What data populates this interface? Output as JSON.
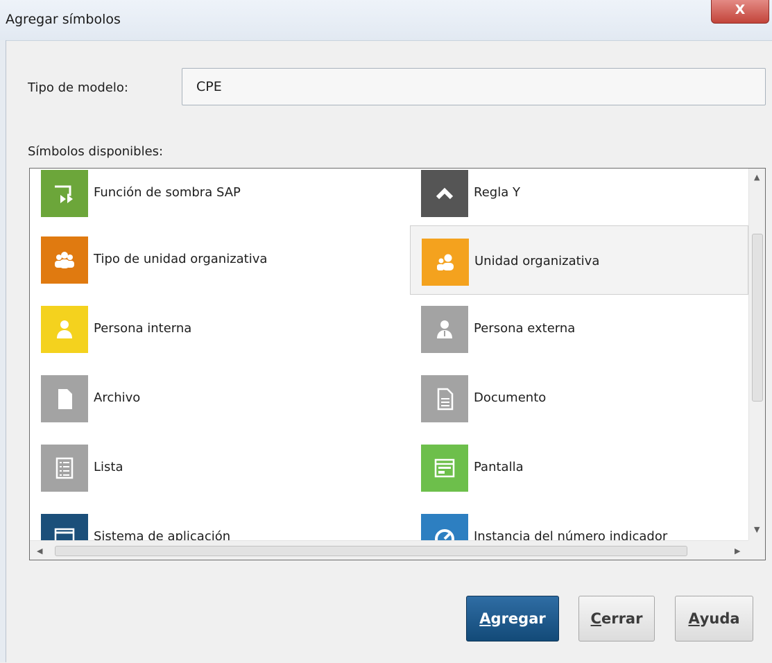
{
  "window": {
    "title": "Agregar símbolos",
    "close_glyph": "X"
  },
  "model_type": {
    "label": "Tipo de modelo:",
    "value": "CPE"
  },
  "symbols": {
    "label": "Símbolos disponibles:",
    "items": [
      {
        "label": "Función de sombra SAP",
        "icon": "shadow-function-icon",
        "color": "#6ca63a"
      },
      {
        "label": "Regla Y",
        "icon": "and-rule-icon",
        "color": "#555555"
      },
      {
        "label": "Tipo de unidad organizativa",
        "icon": "org-unit-type-icon",
        "color": "#e07a10"
      },
      {
        "label": "Unidad organizativa",
        "icon": "org-unit-icon",
        "color": "#f4a21e",
        "selected": true
      },
      {
        "label": "Persona interna",
        "icon": "internal-person-icon",
        "color": "#f4d21e"
      },
      {
        "label": "Persona externa",
        "icon": "external-person-icon",
        "color": "#a3a3a3"
      },
      {
        "label": "Archivo",
        "icon": "file-icon",
        "color": "#a3a3a3"
      },
      {
        "label": "Documento",
        "icon": "document-icon",
        "color": "#a3a3a3"
      },
      {
        "label": "Lista",
        "icon": "list-icon",
        "color": "#a3a3a3"
      },
      {
        "label": "Pantalla",
        "icon": "screen-icon",
        "color": "#6dbf4b"
      },
      {
        "label": "Sistema de aplicación",
        "icon": "application-system-icon",
        "color": "#1b4f7a"
      },
      {
        "label": "Instancia del número indicador",
        "icon": "indicator-instance-icon",
        "color": "#2d7fc1"
      }
    ]
  },
  "buttons": {
    "add": {
      "mnemonic": "A",
      "rest": "gregar"
    },
    "close": {
      "mnemonic": "C",
      "rest": "errar"
    },
    "help": {
      "mnemonic": "A",
      "rest": "yuda"
    }
  },
  "colors": {
    "primary_button": "#1b4f7a",
    "close_button": "#c3443a"
  }
}
